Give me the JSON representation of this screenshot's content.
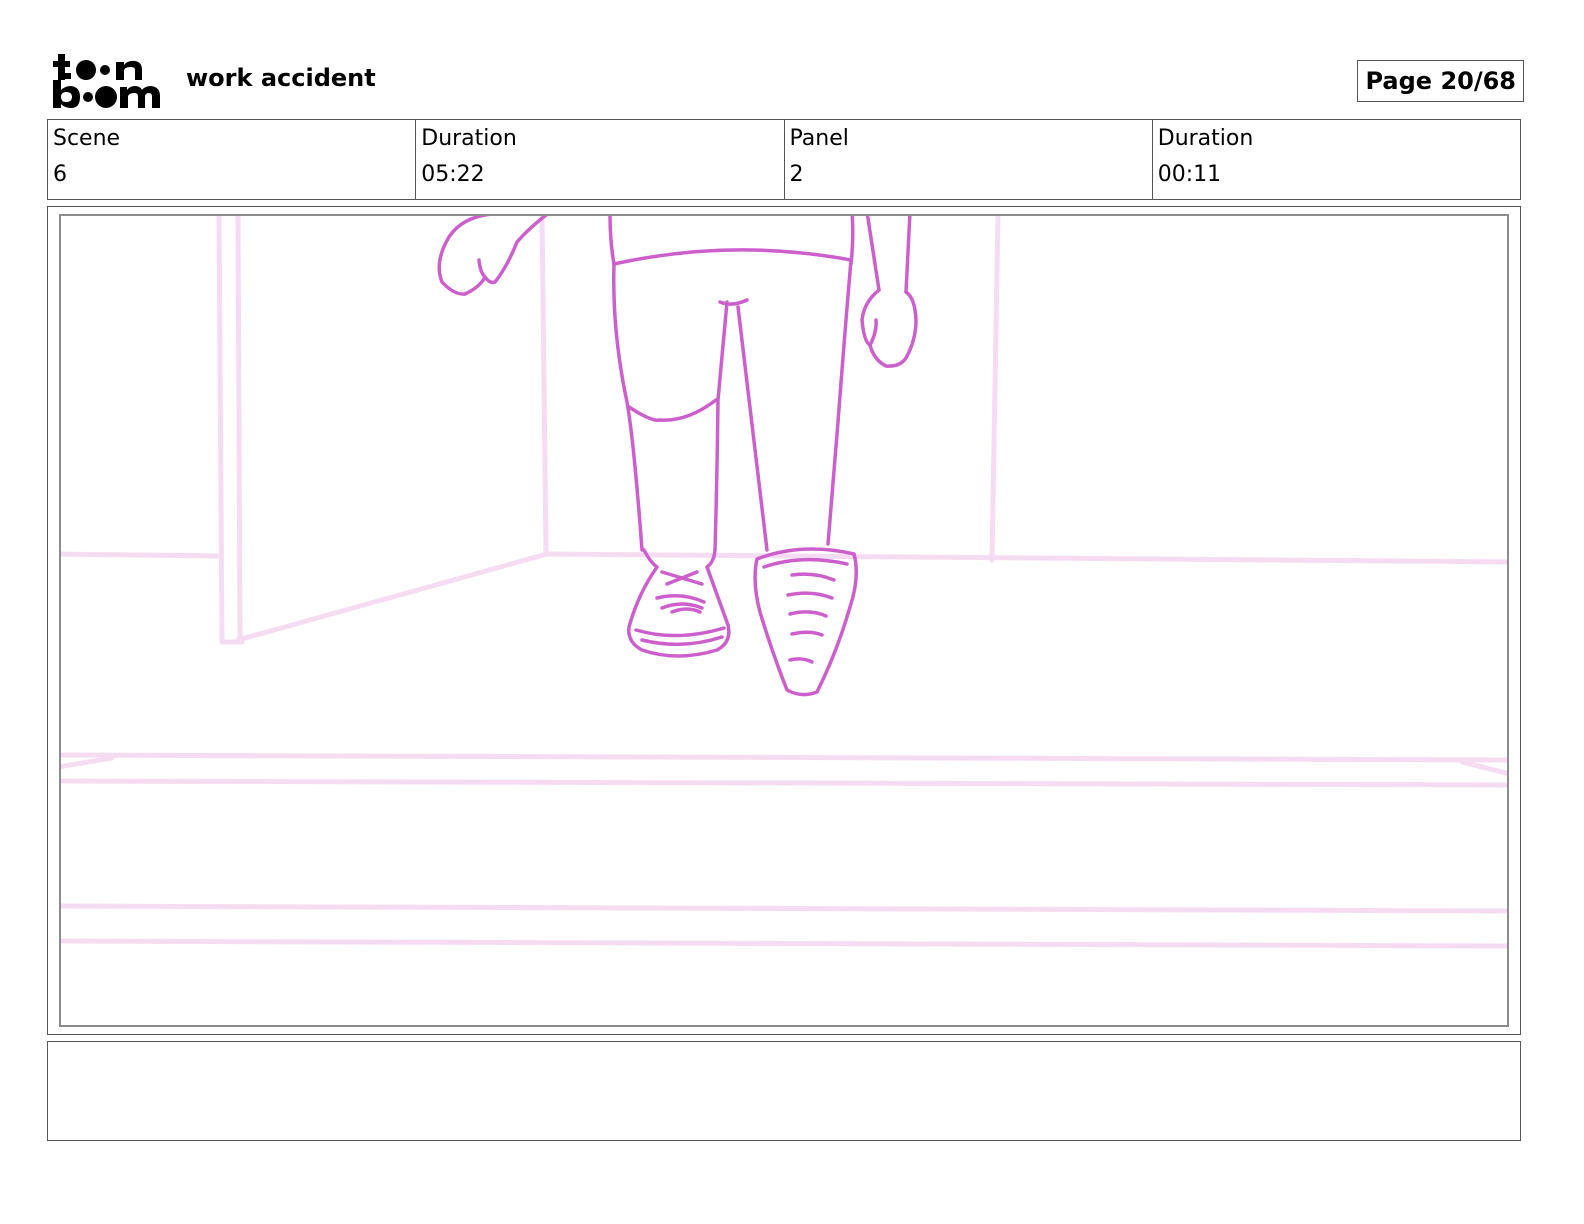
{
  "header": {
    "logo_text": "toon boom",
    "project_title": "work accident",
    "page_label": "Page 20/68"
  },
  "info": [
    {
      "label": "Scene",
      "value": "6"
    },
    {
      "label": "Duration",
      "value": "05:22"
    },
    {
      "label": "Panel",
      "value": "2"
    },
    {
      "label": "Duration",
      "value": "00:11"
    }
  ],
  "panel": {
    "drawing": "storyboard-sketch",
    "sketch_color": "#cc5fcc",
    "background_line_color": "#f6dcf3"
  },
  "notes": {
    "text": ""
  }
}
